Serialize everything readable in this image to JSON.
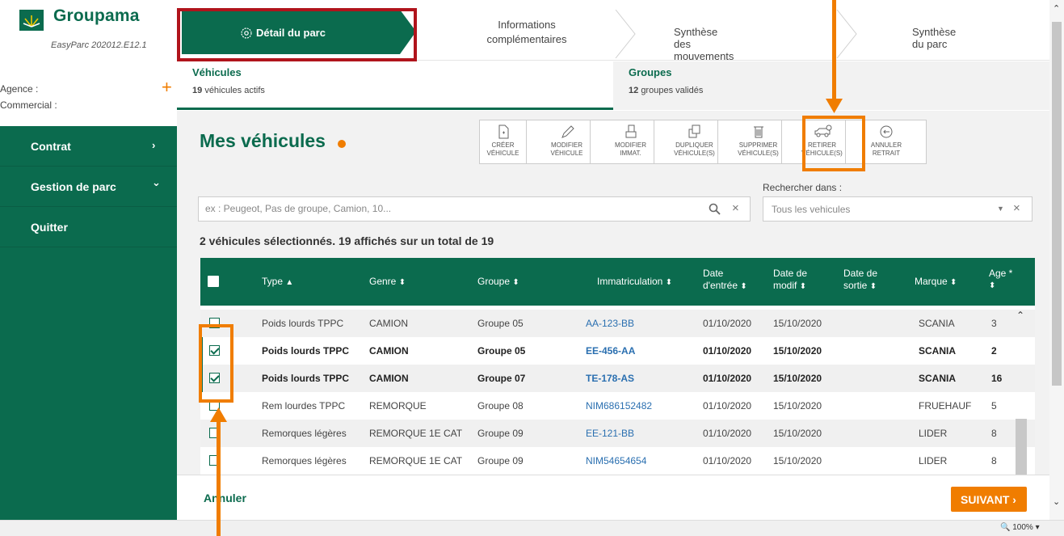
{
  "brand": {
    "name": "Groupama",
    "version": "EasyParc 202012.E12.1"
  },
  "sidebar": {
    "agency_label": "Agence :",
    "commercial_label": "Commercial :",
    "items": [
      {
        "label": "Contrat",
        "chevron": "›"
      },
      {
        "label": "Gestion de parc",
        "chevron": "⌄"
      },
      {
        "label": "Quitter",
        "chevron": ""
      }
    ]
  },
  "stepper": {
    "steps": [
      {
        "label": "Détail du parc",
        "active": true
      },
      {
        "label_line1": "Informations",
        "label_line2": "complémentaires"
      },
      {
        "label": "Synthèse des mouvements"
      },
      {
        "label": "Synthèse du parc"
      }
    ]
  },
  "subtabs": {
    "vehicles": {
      "title": "Véhicules",
      "count": "19",
      "text": "véhicules actifs"
    },
    "groups": {
      "title": "Groupes",
      "count": "12",
      "text": "groupes validés"
    }
  },
  "main": {
    "title": "Mes véhicules"
  },
  "toolbar": [
    {
      "line1": "CRÉER",
      "line2": "VÉHICULE",
      "icon": "file-icon"
    },
    {
      "line1": "MODIFIER",
      "line2": "VÉHICULE",
      "icon": "pencil-icon"
    },
    {
      "line1": "MODIFIER",
      "line2": "IMMAT.",
      "icon": "plate-icon"
    },
    {
      "line1": "DUPLIQUER",
      "line2": "VÉHICULE(S)",
      "icon": "duplicate-icon"
    },
    {
      "line1": "SUPPRIMER",
      "line2": "VÉHICULE(S)",
      "icon": "trash-icon"
    },
    {
      "line1": "RETIRER",
      "line2": "VÉHICULE(S)",
      "icon": "remove-car-icon"
    },
    {
      "line1": "ANNULER",
      "line2": "RETRAIT",
      "icon": "undo-icon"
    }
  ],
  "search": {
    "placeholder": "ex : Peugeot, Pas de groupe, Camion, 10...",
    "value": "",
    "in_label": "Rechercher dans :",
    "in_value": "Tous les vehicules"
  },
  "selection_summary": "2 véhicules sélectionnés. 19 affichés sur un total de 19",
  "table": {
    "headers": {
      "type": "Type",
      "genre": "Genre",
      "groupe": "Groupe",
      "immat": "Immatriculation",
      "date_entree_1": "Date",
      "date_entree_2": "d'entrée",
      "date_modif_1": "Date de",
      "date_modif_2": "modif",
      "date_sortie_1": "Date de",
      "date_sortie_2": "sortie",
      "marque": "Marque",
      "age": "Age *"
    },
    "rows": [
      {
        "type": "Poids lourds TPPC",
        "genre": "CAMION",
        "groupe": "Groupe 05",
        "immat": "AA-123-BB",
        "entree": "01/10/2020",
        "modif": "15/10/2020",
        "sortie": "",
        "marque": "SCANIA",
        "age": "3",
        "selected": false
      },
      {
        "type": "Poids lourds TPPC",
        "genre": "CAMION",
        "groupe": "Groupe 05",
        "immat": "EE-456-AA",
        "entree": "01/10/2020",
        "modif": "15/10/2020",
        "sortie": "",
        "marque": "SCANIA",
        "age": "2",
        "selected": true
      },
      {
        "type": "Poids lourds TPPC",
        "genre": "CAMION",
        "groupe": "Groupe 07",
        "immat": "TE-178-AS",
        "entree": "01/10/2020",
        "modif": "15/10/2020",
        "sortie": "",
        "marque": "SCANIA",
        "age": "16",
        "selected": true
      },
      {
        "type": "Rem lourdes TPPC",
        "genre": "REMORQUE",
        "groupe": "Groupe 08",
        "immat": "NIM686152482",
        "entree": "01/10/2020",
        "modif": "15/10/2020",
        "sortie": "",
        "marque": "FRUEHAUF",
        "age": "5",
        "selected": false
      },
      {
        "type": "Remorques légères",
        "genre": "REMORQUE 1E CAT",
        "groupe": "Groupe 09",
        "immat": "EE-121-BB",
        "entree": "01/10/2020",
        "modif": "15/10/2020",
        "sortie": "",
        "marque": "LIDER",
        "age": "8",
        "selected": false
      },
      {
        "type": "Remorques légères",
        "genre": "REMORQUE 1E CAT",
        "groupe": "Groupe 09",
        "immat": "NIM54654654",
        "entree": "01/10/2020",
        "modif": "15/10/2020",
        "sortie": "",
        "marque": "LIDER",
        "age": "8",
        "selected": false
      }
    ]
  },
  "footer": {
    "cancel": "Annuler",
    "next": "SUIVANT ›"
  },
  "status": {
    "zoom": "🔍 100%  ▾"
  },
  "colors": {
    "brand_green": "#0b6b4e",
    "accent_orange": "#f07d00",
    "highlight_red": "#b0141c",
    "link_blue": "#2a6fb0"
  }
}
